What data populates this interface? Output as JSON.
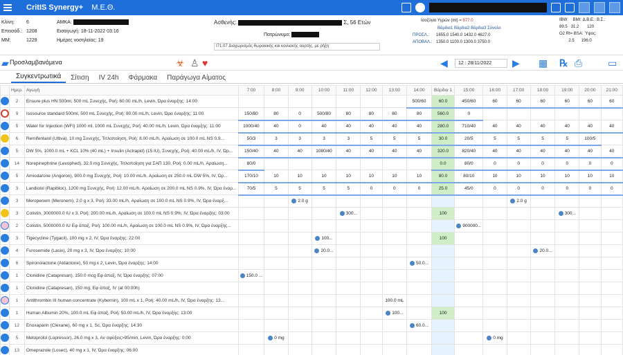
{
  "app": {
    "name": "CritIS Synergy+",
    "unit": "Μ.Ε.Θ."
  },
  "patient": {
    "bed_label": "Κλίνη:",
    "bed": "6",
    "admission_label": "Επεισόδ.:",
    "admission": "1208",
    "im_label": "ΜΜ:",
    "im": "1229",
    "amka_label": "ΑΜΚΑ:",
    "entry_label": "Εισαγωγή:",
    "entry": "18-11-2022 03:16",
    "days_label": "Ημέρες νοσηλείας:",
    "days": "19",
    "patient_label": "Ασθενής:",
    "age": "Σ, 56 Ετών",
    "father_label": "Πατρώνυμο:",
    "diagnosis": "I71.07 Διαχωρισμός θωρακικής και κοιλιακής αορτής, με ρήξη"
  },
  "balance": {
    "title": "Ισοζύγιο Υγρών (ml) =",
    "total": "877.0",
    "cols": [
      "Βάρδια1",
      "Βάρδια2",
      "Βάρδια3",
      "Σύνολο"
    ],
    "rows": [
      {
        "label": "ΠΡΟΣΛ.:",
        "values": [
          "1655.0",
          "1540.0",
          "1432.0",
          "4627.0"
        ]
      },
      {
        "label": "ΑΠΟΒΑΛ.:",
        "values": [
          "1350.0",
          "1100.0",
          "1300.0",
          "3750.0"
        ]
      }
    ]
  },
  "metrics": {
    "ibw_label": "IBW:",
    "bmi_label": "BMI:",
    "abe_label": "Δ.Β.Ε.:",
    "bs_label": "B.Σ.:",
    "ibw": "89.5",
    "bmi": "31.2",
    "bs": "120",
    "o2_label": "Ο2 Rt=",
    "bsa_label": "BSA:",
    "bsa": "2.5",
    "height_label": "Ύψος:",
    "height": "196.0"
  },
  "toolbar": {
    "label": "Προσλαμβανόμενα",
    "date": "12 : 28/11/2022"
  },
  "tabs": [
    "Συγκεντρωτικά",
    "Σίτιση",
    "IV 24h",
    "Φάρμακα",
    "Παράγωγα Αίματος"
  ],
  "grid": {
    "col_hemera": "Ημερ.",
    "col_agogi": "Αγωγή",
    "times": [
      "7:00",
      "8:00",
      "9:00",
      "10:00",
      "11:00",
      "12:00",
      "13:00",
      "14:00",
      "Βάρδια 1",
      "15:00",
      "16:00",
      "17:00",
      "18:00",
      "19:00",
      "20:00",
      "21:00"
    ],
    "rows": [
      {
        "icon": "blue",
        "day": "2",
        "name": "Ensure plus HN 500ml, 500 mL Συνεχής, Ροή: 60.00 mL/h, Levin, Ώρα έναρξης: 14:00",
        "cells": [
          "",
          "",
          "",
          "",
          "",
          "",
          "",
          "500/60",
          "60.0",
          "450/60",
          "60",
          "60",
          "60",
          "60",
          "60",
          "60"
        ]
      },
      {
        "icon": "redx",
        "day": "9",
        "name": "Isosource standard 500ml, 500 mL Συνεχής, Ροή: 80.00 mL/h, Levin, Ώρα έναρξης: 11:00",
        "cells": [
          "150/80",
          "80",
          "0",
          "500/80",
          "80",
          "80",
          "80",
          "80",
          "560.0",
          "0",
          "",
          "",
          "",
          "",
          "",
          ""
        ]
      },
      {
        "icon": "blue",
        "day": "5",
        "name": "Water for Injection (WFI) 1000 ml, 1000 mL Συνεχής, Ροή: 40.00 mL/h, Levin, Ώρα έναρξης: 11:00",
        "cells": [
          "1000/40",
          "40",
          "0",
          "40",
          "40",
          "40",
          "40",
          "40",
          "280.0",
          "710/40",
          "40",
          "40",
          "40",
          "40",
          "40",
          "40"
        ]
      },
      {
        "icon": "yellow",
        "day": "6",
        "name": "Remifentanil (Ultiva), 10 mg Συνεχής, Τιτλοποίηση, Ροή: 8.00 mL/h, Αραίωση σε 100.0 mL NS 0.9...",
        "cells": [
          "50/3",
          "3",
          "3",
          "3",
          "3",
          "5",
          "5",
          "5",
          "30.0",
          "20/5",
          "5",
          "5",
          "5",
          "5",
          "100/5",
          ""
        ]
      },
      {
        "icon": "blue",
        "day": "5",
        "name": "DW 5%, 1000.0 mL + KCL 10% (40 mL) + Insulin (Actrapid) (15 IU), Συνεχής, Ροή: 40.00 mL/h, IV, Ώρ...",
        "cells": [
          "150/40",
          "40",
          "40",
          "1080/40",
          "40",
          "40",
          "40",
          "40",
          "320.0",
          "820/40",
          "40",
          "40",
          "40",
          "40",
          "40",
          "40"
        ]
      },
      {
        "icon": "blue",
        "day": "14",
        "name": "Norepinephrine (Levophed), 32.0 mg Συνεχής, Τιτλοποίηση για ΣΑΠ 130, Ροή: 0.00 mL/h, Αραίωση...",
        "cells": [
          "80/0",
          "",
          "",
          "",
          "",
          "",
          "",
          "",
          "0.0",
          "80/0",
          "0",
          "0",
          "0",
          "0",
          "0",
          "0"
        ]
      },
      {
        "icon": "blue",
        "day": "5",
        "name": "Amiodarone (Angoron), 900.0 mg Συνεχής, Ροή: 10.00 mL/h, Αραίωση σε 250.0 mL DW 5%, IV, Ώρ...",
        "cells": [
          "170/10",
          "10",
          "10",
          "10",
          "10",
          "10",
          "10",
          "10",
          "80.0",
          "80/10",
          "10",
          "10",
          "10",
          "10",
          "10",
          "10"
        ]
      },
      {
        "icon": "blue",
        "day": "3",
        "name": "Landiolol (Rapibloc), 1200 mg Συνεχής, Ροή: 12.00 mL/h, Αραίωση σε 200.0 mL NS 0.9%, IV, Ώρα έναρ...",
        "cells": [
          "70/5",
          "5",
          "5",
          "5",
          "5",
          "0",
          "0",
          "0",
          "25.0",
          "45/0",
          "0",
          "0",
          "0",
          "0",
          "0",
          "0"
        ]
      },
      {
        "icon": "blue",
        "day": "3",
        "name": "Meropenem (Meronem), 2.0 g x 3, Ροή: 33.00 mL/h, Αραίωση σε 100.0 mL NS 0.9%, IV, Ώρα έναρξ...",
        "cells": [
          "",
          "",
          "2.0 g",
          "",
          "",
          "",
          "",
          "",
          "",
          "",
          "",
          "2.0 g",
          "",
          "",
          "",
          ""
        ]
      },
      {
        "icon": "yellow",
        "day": "3",
        "name": "Colistin, 3000000.0 IU x 3, Ροή: 200.00 mL/h, Αραίωση σε 100.0 mL NS 0.9%, IV, Ώρα έναρξης: 03:00",
        "cells": [
          "",
          "",
          "",
          "",
          "300...",
          "",
          "",
          "",
          "100",
          "",
          "",
          "",
          "",
          "300...",
          "",
          ""
        ]
      },
      {
        "icon": "pink",
        "day": "2",
        "name": "Colistin, 5000000.0 IU Εφ άπαξ, Ροή: 100.00 mL/h, Αραίωση σε 100.0 mL NS 0.9%, IV, Ώρα έναρξης...",
        "cells": [
          "",
          "",
          "",
          "",
          "",
          "",
          "",
          "",
          "",
          "900000...",
          "",
          "",
          "",
          "",
          "",
          ""
        ]
      },
      {
        "icon": "blue",
        "day": "3",
        "name": "Tigecycline (Tygacil), 100 mg x 2, IV, Ώρα έναρξης: 22:00",
        "cells": [
          "",
          "",
          "",
          "100...",
          "",
          "",
          "",
          "",
          "100",
          "",
          "",
          "",
          "",
          "",
          "",
          ""
        ]
      },
      {
        "icon": "blue",
        "day": "4",
        "name": "Furosemide (Lasix), 20 mg x 3, IV, Ώρα έναρξης: 10:00",
        "cells": [
          "",
          "",
          "",
          "20.0...",
          "",
          "",
          "",
          "",
          "",
          "",
          "",
          "",
          "20.0...",
          "",
          "",
          ""
        ]
      },
      {
        "icon": "blue",
        "day": "6",
        "name": "Spironolactone (Aldactone), 50 mg x 2, Levin, Ώρα έναρξης: 14:00",
        "cells": [
          "",
          "",
          "",
          "",
          "",
          "",
          "",
          "50.0...",
          "",
          "",
          "",
          "",
          "",
          "",
          "",
          ""
        ]
      },
      {
        "icon": "blue",
        "day": "1",
        "name": "Clonidine (Catapresan), 150.0 mcg Εφ άπαξ, IV, Ώρα έναρξης: 07:00",
        "cells": [
          "150.0 ...",
          "",
          "",
          "",
          "",
          "",
          "",
          "",
          "",
          "",
          "",
          "",
          "",
          "",
          "",
          ""
        ]
      },
      {
        "icon": "blue",
        "day": "1",
        "name": "Clonidine (Catapresan), 150 mg, Εφ άπαξ, IV (at 00:00h)",
        "cells": [
          "",
          "",
          "",
          "",
          "",
          "",
          "",
          "",
          "",
          "",
          "",
          "",
          "",
          "",
          "",
          ""
        ]
      },
      {
        "icon": "pink",
        "day": "1",
        "name": "Antithrombin III human concentrate (Kybernin), 100 mL x 1, Ροή: 40.00 mL/h, IV, Ώρα έναρξης: 13...",
        "cells": [
          "",
          "",
          "",
          "",
          "",
          "",
          "100.0 mL",
          "",
          "",
          "",
          "",
          "",
          "",
          "",
          "",
          ""
        ]
      },
      {
        "icon": "blue",
        "day": "1",
        "name": "Human Albumin 20%, 100.0 mL Εφ άπαξ, Ροή: 50.00 mL/h, IV, Ώρα έναρξης: 13:00",
        "cells": [
          "",
          "",
          "",
          "",
          "",
          "",
          "100...",
          "",
          "100",
          "",
          "",
          "",
          "",
          "",
          "",
          ""
        ]
      },
      {
        "icon": "blue",
        "day": "12",
        "name": "Enoxaparin (Clexane), 60 mg x 1, Sc, Ώρα έναρξης: 14:30",
        "cells": [
          "",
          "",
          "",
          "",
          "",
          "",
          "",
          "60.0...",
          "",
          "",
          "",
          "",
          "",
          "",
          "",
          ""
        ]
      },
      {
        "icon": "blue",
        "day": "5",
        "name": "Metoprolol (Lopressor), 26.0 mg x 3, Αν σφύξεις>95/min, Levin, Ώρα έναρξης: 0:00",
        "cells": [
          "",
          "0 mg",
          "",
          "",
          "",
          "",
          "",
          "",
          "",
          "",
          "0 mg",
          "",
          "",
          "",
          "",
          ""
        ]
      },
      {
        "icon": "blue",
        "day": "13",
        "name": "Omeprazole (Losec), 40 mg x 1, IV, Ώρα έναρξης: 06:00",
        "cells": [
          "",
          "",
          "",
          "",
          "",
          "",
          "",
          "",
          "",
          "",
          "",
          "",
          "",
          "",
          "",
          ""
        ]
      }
    ]
  },
  "colors": {
    "accent": "#1e6fd9",
    "shift_col": "#cfeec7"
  }
}
